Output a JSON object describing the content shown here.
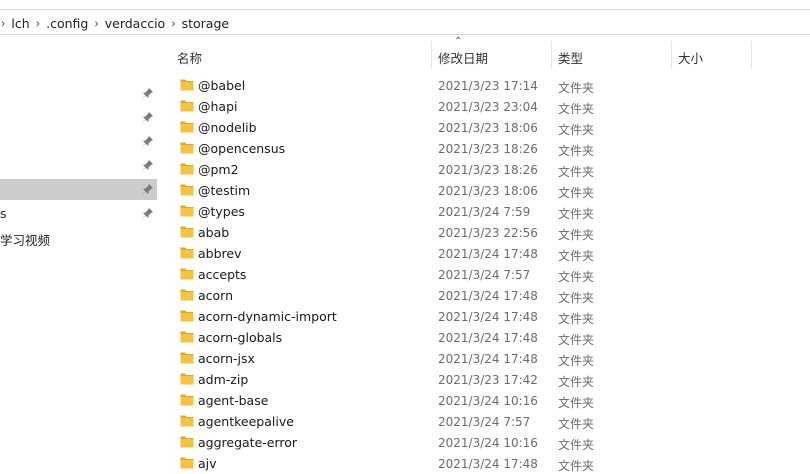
{
  "breadcrumb": [
    "lch",
    ".config",
    "verdaccio",
    "storage"
  ],
  "nav": {
    "items": [
      {
        "label": "",
        "pinned": true,
        "selected": false
      },
      {
        "label": "",
        "pinned": true,
        "selected": false
      },
      {
        "label": "",
        "pinned": true,
        "selected": false
      },
      {
        "label": "",
        "pinned": true,
        "selected": false
      },
      {
        "label": "",
        "pinned": true,
        "selected": true
      },
      {
        "label": "s",
        "pinned": true,
        "selected": false
      },
      {
        "label": "学习视频",
        "pinned": false,
        "selected": false
      }
    ]
  },
  "columns": {
    "name": "名称",
    "modified": "修改日期",
    "type": "类型",
    "size": "大小"
  },
  "files": [
    {
      "name": "@babel",
      "modified": "2021/3/23 17:14",
      "type": "文件夹"
    },
    {
      "name": "@hapi",
      "modified": "2021/3/23 23:04",
      "type": "文件夹"
    },
    {
      "name": "@nodelib",
      "modified": "2021/3/23 18:06",
      "type": "文件夹"
    },
    {
      "name": "@opencensus",
      "modified": "2021/3/23 18:26",
      "type": "文件夹"
    },
    {
      "name": "@pm2",
      "modified": "2021/3/23 18:26",
      "type": "文件夹"
    },
    {
      "name": "@testim",
      "modified": "2021/3/23 18:06",
      "type": "文件夹"
    },
    {
      "name": "@types",
      "modified": "2021/3/24 7:59",
      "type": "文件夹"
    },
    {
      "name": "abab",
      "modified": "2021/3/23 22:56",
      "type": "文件夹"
    },
    {
      "name": "abbrev",
      "modified": "2021/3/24 17:48",
      "type": "文件夹"
    },
    {
      "name": "accepts",
      "modified": "2021/3/24 7:57",
      "type": "文件夹"
    },
    {
      "name": "acorn",
      "modified": "2021/3/24 17:48",
      "type": "文件夹"
    },
    {
      "name": "acorn-dynamic-import",
      "modified": "2021/3/24 17:48",
      "type": "文件夹"
    },
    {
      "name": "acorn-globals",
      "modified": "2021/3/24 17:48",
      "type": "文件夹"
    },
    {
      "name": "acorn-jsx",
      "modified": "2021/3/24 17:48",
      "type": "文件夹"
    },
    {
      "name": "adm-zip",
      "modified": "2021/3/23 17:42",
      "type": "文件夹"
    },
    {
      "name": "agent-base",
      "modified": "2021/3/24 10:16",
      "type": "文件夹"
    },
    {
      "name": "agentkeepalive",
      "modified": "2021/3/24 7:57",
      "type": "文件夹"
    },
    {
      "name": "aggregate-error",
      "modified": "2021/3/24 10:16",
      "type": "文件夹"
    },
    {
      "name": "ajv",
      "modified": "2021/3/24 17:48",
      "type": "文件夹"
    }
  ],
  "colors": {
    "folder": "#f5c242",
    "folder_dark": "#e2a91b",
    "selected_nav": "#cccccc"
  },
  "icons": {
    "pin": "pin-icon",
    "folder": "folder-icon",
    "chevron": "chevron-right-icon",
    "sort": "sort-up-icon"
  }
}
